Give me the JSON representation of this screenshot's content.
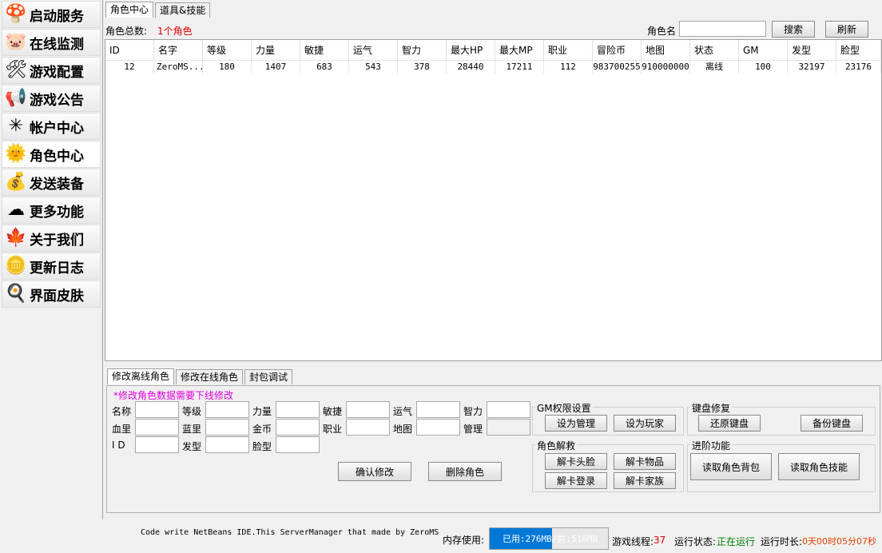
{
  "sidebar": {
    "items": [
      {
        "label": "启动服务",
        "icon": "mushroom-icon",
        "glyph": "🍄"
      },
      {
        "label": "在线监测",
        "icon": "pig-icon",
        "glyph": "🐷"
      },
      {
        "label": "游戏配置",
        "icon": "tools-icon",
        "glyph": "🛠"
      },
      {
        "label": "游戏公告",
        "icon": "megaphone-icon",
        "glyph": "📢"
      },
      {
        "label": "帐户中心",
        "icon": "pinwheel-icon",
        "glyph": "✳"
      },
      {
        "label": "角色中心",
        "icon": "sun-icon",
        "glyph": "🌞"
      },
      {
        "label": "发送装备",
        "icon": "bag-icon",
        "glyph": "💰"
      },
      {
        "label": "更多功能",
        "icon": "cloud-icon",
        "glyph": "☁"
      },
      {
        "label": "关于我们",
        "icon": "leaf-icon",
        "glyph": "🍁"
      },
      {
        "label": "更新日志",
        "icon": "coin-icon",
        "glyph": "🪙"
      },
      {
        "label": "界面皮肤",
        "icon": "egg-icon",
        "glyph": "🍳"
      }
    ],
    "active_index": 5
  },
  "top_tabs": [
    "角色中心",
    "道具&技能"
  ],
  "search": {
    "total_label": "角色总数:",
    "total_value": "1个角色",
    "name_label": "角色名",
    "name_value": "",
    "search_button": "搜索",
    "refresh_button": "刷新"
  },
  "table": {
    "columns": [
      "ID",
      "名字",
      "等级",
      "力量",
      "敏捷",
      "运气",
      "智力",
      "最大HP",
      "最大MP",
      "职业",
      "冒险币",
      "地图",
      "状态",
      "GM",
      "发型",
      "脸型"
    ],
    "rows": [
      [
        "12",
        "ZeroMS...",
        "180",
        "1407",
        "683",
        "543",
        "378",
        "28440",
        "17211",
        "112",
        "983700255",
        "910000000",
        "离线",
        "100",
        "32197",
        "23176"
      ]
    ]
  },
  "bottom_tabs": [
    "修改离线角色",
    "修改在线角色",
    "封包调试"
  ],
  "edit": {
    "notice": "*修改角色数据需要下线修改",
    "labels": {
      "name": "名称",
      "level": "等级",
      "str": "力量",
      "dex": "敏捷",
      "luk": "运气",
      "int": "智力",
      "hp": "血里",
      "mp": "蓝里",
      "meso": "金币",
      "job": "职业",
      "map": "地图",
      "gm": "管理",
      "id": "I  D",
      "hair": "发型",
      "face": "脸型"
    },
    "confirm_button": "确认修改",
    "delete_button": "删除角色"
  },
  "gm_group": {
    "title": "GM权限设置",
    "set_admin": "设为管理",
    "set_player": "设为玩家"
  },
  "unlock_group": {
    "title": "角色解救",
    "unlock_face": "解卡头脸",
    "unlock_item": "解卡物品",
    "unlock_login": "解卡登录",
    "unlock_family": "解卡家族"
  },
  "keymap_group": {
    "title": "键盘修复",
    "restore": "还原键盘",
    "backup": "备份键盘"
  },
  "advanced_group": {
    "title": "进阶功能",
    "read_bag": "读取角色背包",
    "read_skill": "读取角色技能"
  },
  "status": {
    "credit": "Code write NetBeans IDE.This ServerManager that made by ZeroMS",
    "mem_label": "内存使用:",
    "mem_used_text": "已用:276MB/共:516MB",
    "mem_fraction": 0.53,
    "threads_label": "游戏线程:",
    "threads_value": "37",
    "run_state_label": "运行状态:",
    "run_state_value": "正在运行",
    "uptime_label": "运行时长:",
    "uptime_value": "0天00时05分07秒"
  },
  "colors": {
    "accent": "#0078d7",
    "alert": "#e00000",
    "notice": "#e000e0",
    "running": "#008000"
  }
}
